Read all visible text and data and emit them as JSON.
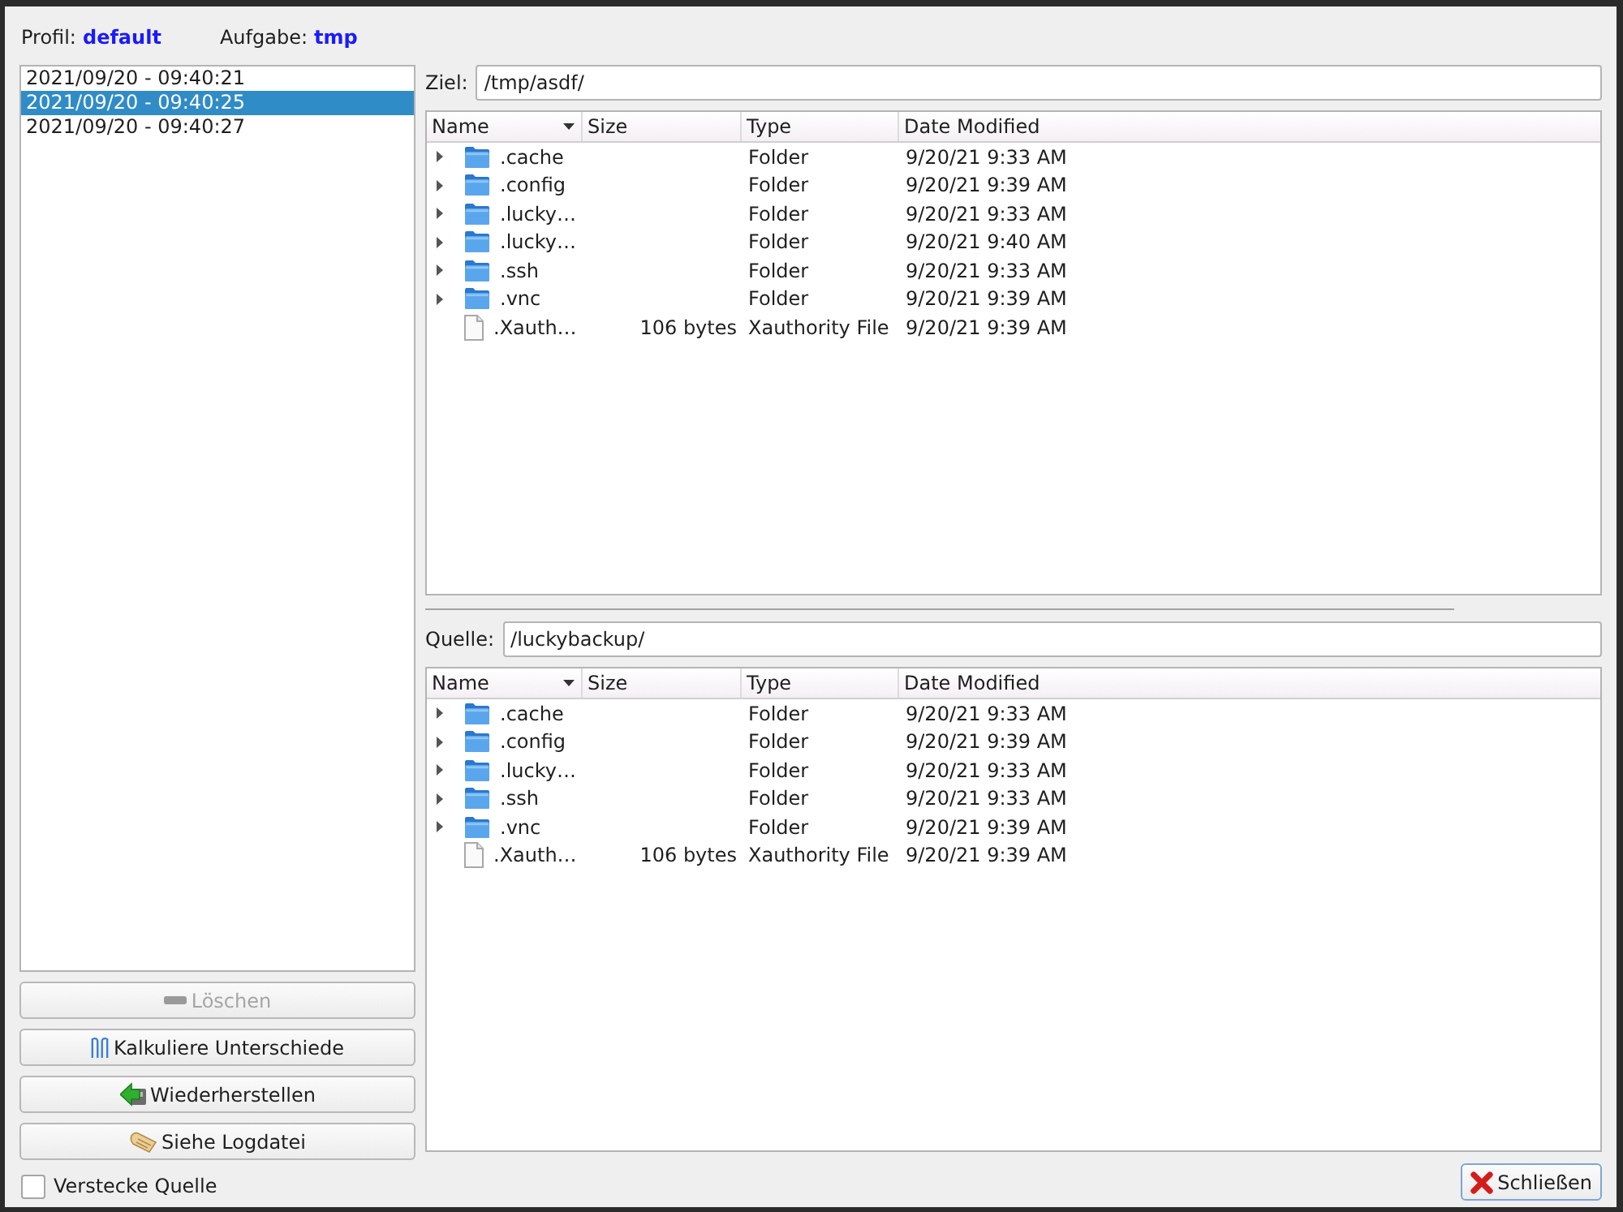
{
  "header": {
    "profile_label": "Profil:",
    "profile": "default",
    "task_label": "Aufgabe:",
    "task": "tmp"
  },
  "snapshots": [
    {
      "label": "2021/09/20 - 09:40:21",
      "selected": false
    },
    {
      "label": "2021/09/20 - 09:40:25",
      "selected": true
    },
    {
      "label": "2021/09/20 - 09:40:27",
      "selected": false
    }
  ],
  "actions": [
    {
      "kind": "delete",
      "label": "Löschen",
      "disabled": true
    },
    {
      "kind": "compare",
      "label": "Kalkuliere Unterschiede",
      "disabled": false
    },
    {
      "kind": "restore",
      "label": "Wiederherstellen",
      "disabled": false
    },
    {
      "kind": "log",
      "label": "Siehe Logdatei",
      "disabled": false
    }
  ],
  "hide_source": {
    "label": "Verstecke Quelle",
    "checked": false
  },
  "panes": [
    {
      "label": "Ziel:",
      "value": "/tmp/asdf/",
      "columns": [
        {
          "label": "Name",
          "sorted": true
        },
        {
          "label": "Size",
          "sorted": false
        },
        {
          "label": "Type",
          "sorted": false
        },
        {
          "label": "Date Modified",
          "sorted": false
        }
      ],
      "rows": [
        {
          "kind": "folder",
          "name": ".cache",
          "expanded": false,
          "type": "Folder",
          "modified": "9/20/21 9:33 AM"
        },
        {
          "kind": "folder",
          "name": ".config",
          "expanded": false,
          "type": "Folder",
          "modified": "9/20/21 9:39 AM"
        },
        {
          "kind": "folder",
          "name": ".lucky…",
          "expanded": false,
          "type": "Folder",
          "modified": "9/20/21 9:33 AM"
        },
        {
          "kind": "folder",
          "name": ".lucky…",
          "expanded": false,
          "type": "Folder",
          "modified": "9/20/21 9:40 AM"
        },
        {
          "kind": "folder",
          "name": ".ssh",
          "expanded": false,
          "type": "Folder",
          "modified": "9/20/21 9:33 AM"
        },
        {
          "kind": "folder",
          "name": ".vnc",
          "expanded": false,
          "type": "Folder",
          "modified": "9/20/21 9:39 AM"
        },
        {
          "kind": "file",
          "name": ".Xauth…",
          "size": "106 bytes",
          "type": "Xauthority File",
          "modified": "9/20/21 9:39 AM"
        }
      ]
    },
    {
      "label": "Quelle:",
      "value": "/luckybackup/",
      "columns": [
        {
          "label": "Name",
          "sorted": true
        },
        {
          "label": "Size",
          "sorted": false
        },
        {
          "label": "Type",
          "sorted": false
        },
        {
          "label": "Date Modified",
          "sorted": false
        }
      ],
      "rows": [
        {
          "kind": "folder",
          "name": ".cache",
          "expanded": false,
          "type": "Folder",
          "modified": "9/20/21 9:33 AM"
        },
        {
          "kind": "folder",
          "name": ".config",
          "expanded": false,
          "type": "Folder",
          "modified": "9/20/21 9:39 AM"
        },
        {
          "kind": "folder",
          "name": ".lucky…",
          "expanded": false,
          "type": "Folder",
          "modified": "9/20/21 9:33 AM"
        },
        {
          "kind": "folder",
          "name": ".ssh",
          "expanded": false,
          "type": "Folder",
          "modified": "9/20/21 9:33 AM"
        },
        {
          "kind": "folder",
          "name": ".vnc",
          "expanded": false,
          "type": "Folder",
          "modified": "9/20/21 9:39 AM"
        },
        {
          "kind": "file",
          "name": ".Xauth…",
          "size": "106 bytes",
          "type": "Xauthority File",
          "modified": "9/20/21 9:39 AM"
        }
      ]
    }
  ],
  "close_button": {
    "label": "Schließen"
  }
}
